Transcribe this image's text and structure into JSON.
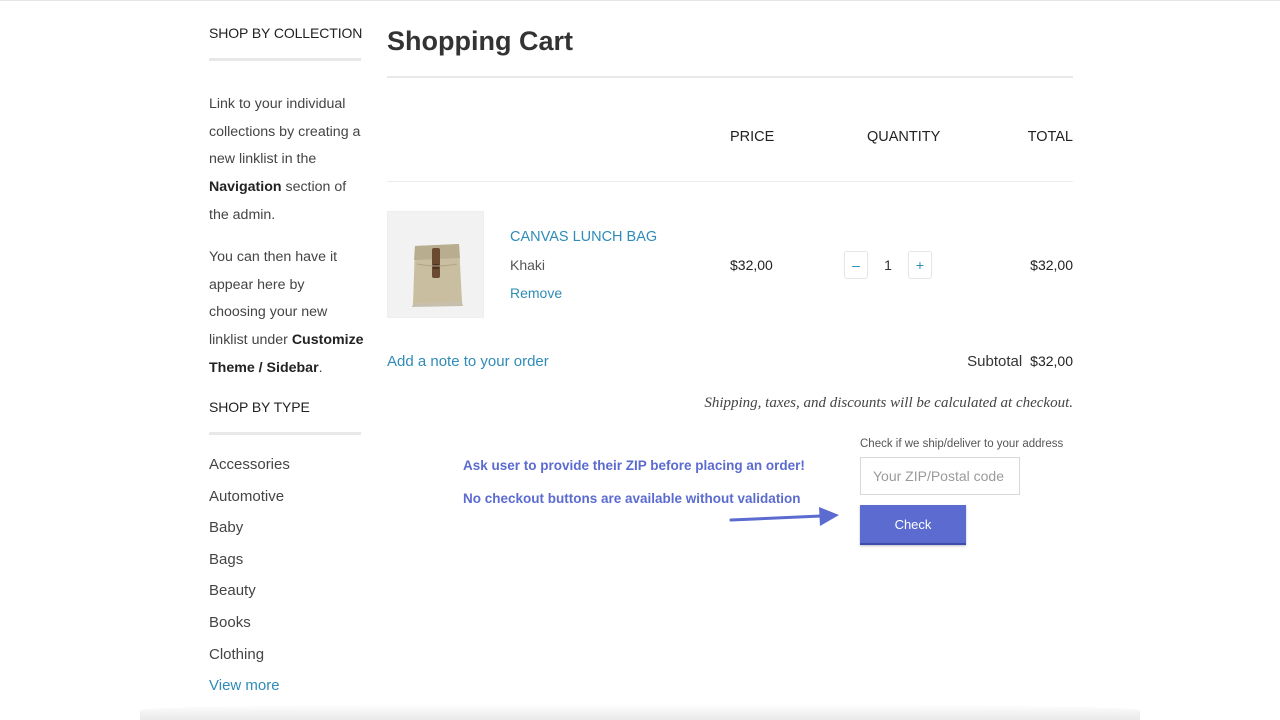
{
  "sidebar": {
    "collection_heading": "SHOP BY COLLECTION",
    "para1_a": "Link to your individual collections by creating a new linklist in the ",
    "para1_bold": "Navigation",
    "para1_b": " section of the admin.",
    "para2_a": "You can then have it appear here by choosing your new linklist under ",
    "para2_bold": "Customize Theme / Sidebar",
    "para2_b": ".",
    "type_heading": "SHOP BY TYPE",
    "types": [
      "Accessories",
      "Automotive",
      "Baby",
      "Bags",
      "Beauty",
      "Books",
      "Clothing"
    ],
    "view_more": "View more"
  },
  "cart": {
    "title": "Shopping Cart",
    "columns": {
      "price": "PRICE",
      "quantity": "QUANTITY",
      "total": "TOTAL"
    },
    "item": {
      "name": "CANVAS LUNCH BAG",
      "variant": "Khaki",
      "remove": "Remove",
      "price": "$32,00",
      "quantity": "1",
      "total": "$32,00",
      "image": "canvas-lunch-bag-photo"
    },
    "qty_minus": "–",
    "qty_plus": "+",
    "add_note": "Add a note to your order",
    "subtotal_label": "Subtotal",
    "subtotal_value": "$32,00",
    "shipping_note": "Shipping, taxes, and discounts will be calculated at checkout."
  },
  "annotation": {
    "line1": "Ask user to provide their ZIP before placing an order!",
    "line2": "No checkout buttons are available without validation",
    "arrow_icon": "arrow-right-icon",
    "color": "#5b6bd0"
  },
  "zip_check": {
    "label": "Check if we ship/deliver to your address",
    "placeholder": "Your ZIP/Postal code",
    "value": "",
    "button": "Check",
    "button_color": "#5b6bd0"
  },
  "colors": {
    "link": "#2f8bb8",
    "text": "#333333"
  }
}
